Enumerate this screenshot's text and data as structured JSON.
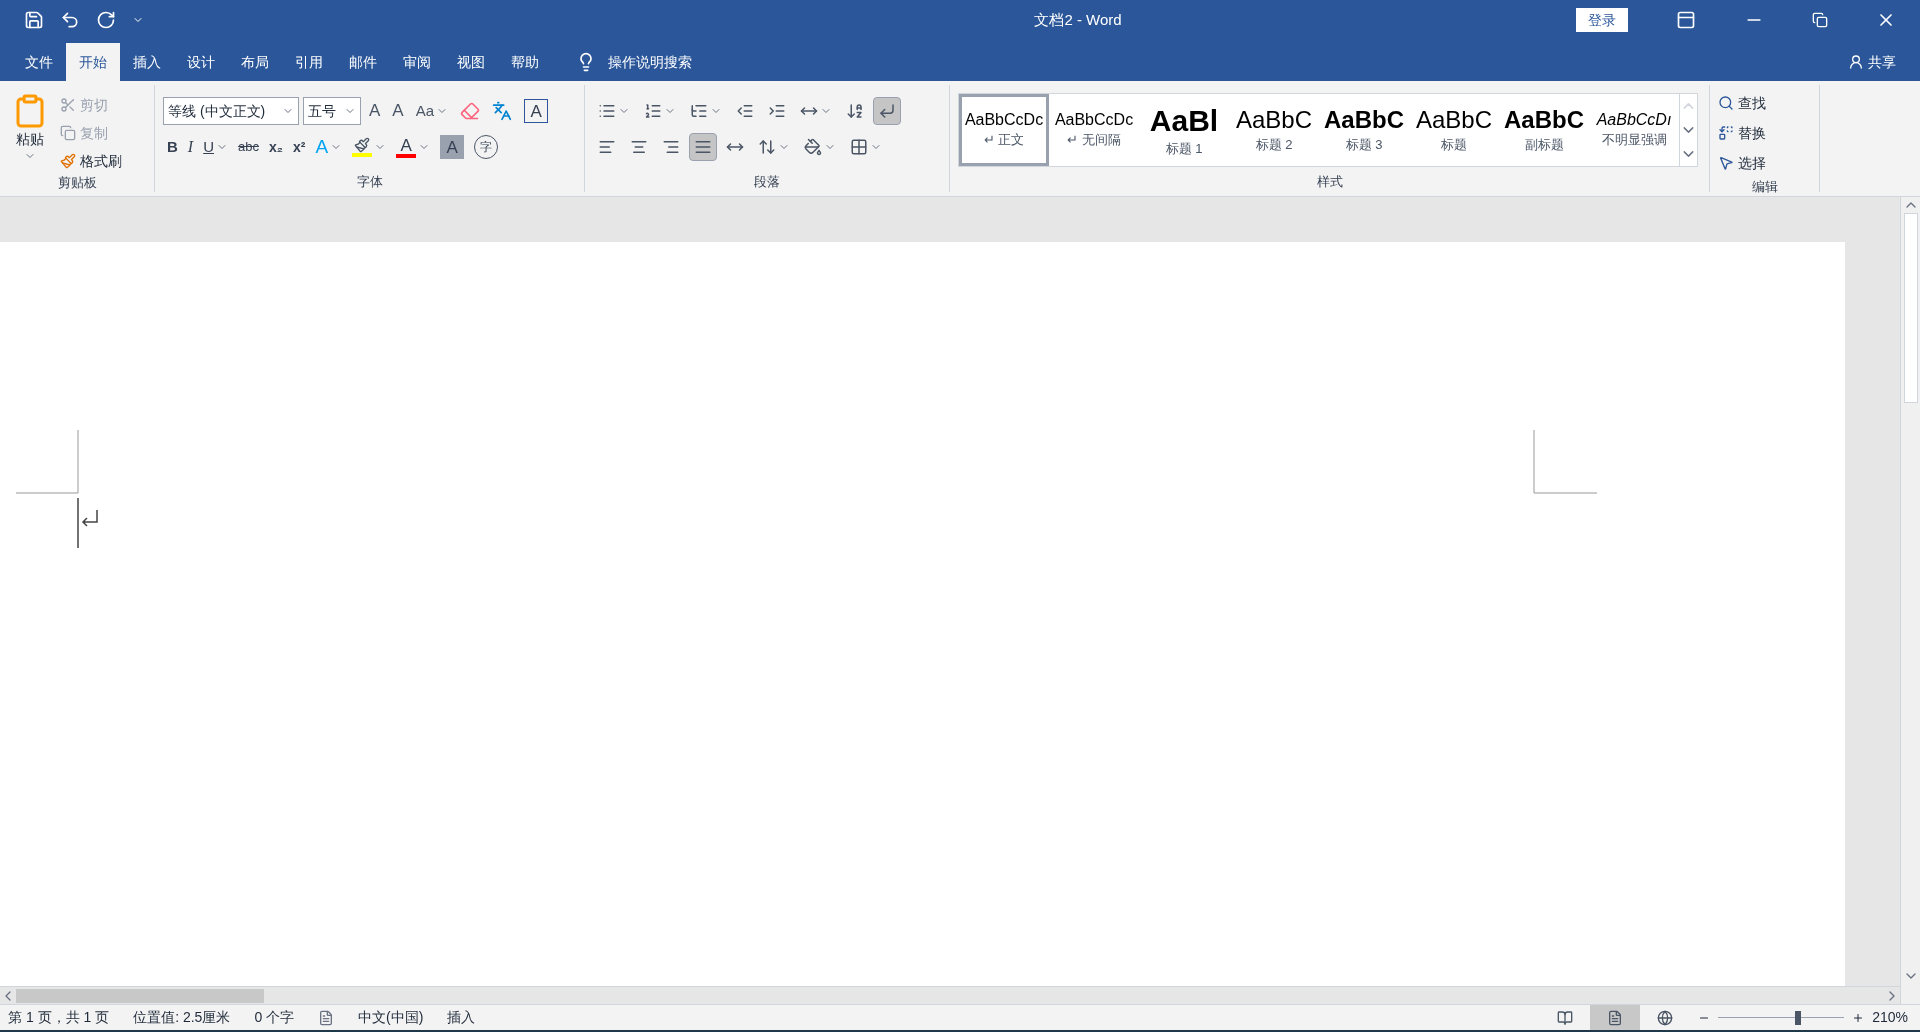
{
  "window": {
    "title": "文档2  -  Word",
    "sign_in": "登录"
  },
  "tabs": [
    {
      "label": "文件",
      "selected": false
    },
    {
      "label": "开始",
      "selected": true
    },
    {
      "label": "插入",
      "selected": false
    },
    {
      "label": "设计",
      "selected": false
    },
    {
      "label": "布局",
      "selected": false
    },
    {
      "label": "引用",
      "selected": false
    },
    {
      "label": "邮件",
      "selected": false
    },
    {
      "label": "审阅",
      "selected": false
    },
    {
      "label": "视图",
      "selected": false
    },
    {
      "label": "帮助",
      "selected": false
    }
  ],
  "tell_me": "操作说明搜索",
  "share": "共享",
  "clipboard": {
    "paste": "粘贴",
    "group": "剪贴板",
    "items": [
      {
        "kind": "cut",
        "label": "剪切",
        "disabled": true
      },
      {
        "kind": "copy",
        "label": "复制",
        "disabled": true
      },
      {
        "kind": "painter",
        "label": "格式刷",
        "disabled": false
      }
    ]
  },
  "font": {
    "name": "等线 (中文正文)",
    "size": "五号",
    "group": "字体",
    "row1": [
      {
        "kind": "grow",
        "label": "A"
      },
      {
        "kind": "shrink",
        "label": "A"
      },
      {
        "kind": "case",
        "label": "Aa"
      },
      {
        "kind": "clear"
      },
      {
        "kind": "phonetic"
      },
      {
        "kind": "border",
        "label": "A"
      }
    ],
    "row2": [
      {
        "kind": "bold",
        "label": "B"
      },
      {
        "kind": "italic",
        "label": "I"
      },
      {
        "kind": "underline",
        "label": "U"
      },
      {
        "kind": "strike",
        "label": "abc"
      },
      {
        "kind": "sub",
        "label": "x₂"
      },
      {
        "kind": "sup",
        "label": "x²"
      },
      {
        "kind": "effect",
        "label": "A"
      },
      {
        "kind": "highlight",
        "color": "#ffff00"
      },
      {
        "kind": "fontcolor",
        "label": "A",
        "color": "#ff0000"
      },
      {
        "kind": "shading",
        "label": "A"
      },
      {
        "kind": "enclose",
        "label": "字"
      }
    ]
  },
  "paragraph": {
    "group": "段落",
    "row1": [
      {
        "kind": "bullets",
        "on": false
      },
      {
        "kind": "numbering",
        "on": false
      },
      {
        "kind": "multilevel",
        "on": false
      },
      {
        "kind": "outdent",
        "on": false
      },
      {
        "kind": "indent",
        "on": false
      },
      {
        "kind": "asian",
        "on": false
      },
      {
        "kind": "sort",
        "on": false
      },
      {
        "kind": "marks",
        "on": true
      }
    ],
    "row2": [
      {
        "kind": "left",
        "on": false
      },
      {
        "kind": "center",
        "on": false
      },
      {
        "kind": "right",
        "on": false
      },
      {
        "kind": "justify",
        "on": true
      },
      {
        "kind": "distribute",
        "on": false
      },
      {
        "kind": "spacing",
        "on": false
      },
      {
        "kind": "shade",
        "on": false
      },
      {
        "kind": "borders",
        "on": false
      }
    ]
  },
  "styles": {
    "group": "样式",
    "items": [
      {
        "sample": "AaBbCcDc",
        "label": "↵ 正文",
        "kind": "normal",
        "selected": true
      },
      {
        "sample": "AaBbCcDc",
        "label": "↵ 无间隔",
        "kind": "normal",
        "selected": false
      },
      {
        "sample": "AaBl",
        "label": "标题 1",
        "kind": "big",
        "selected": false
      },
      {
        "sample": "AaBbC",
        "label": "标题 2",
        "kind": "medium",
        "selected": false
      },
      {
        "sample": "AaBbC",
        "label": "标题 3",
        "kind": "medium-bold",
        "selected": false
      },
      {
        "sample": "AaBbC",
        "label": "标题",
        "kind": "medium",
        "selected": false
      },
      {
        "sample": "AaBbC",
        "label": "副标题",
        "kind": "medium-bold",
        "selected": false
      },
      {
        "sample": "AaBbCcDı",
        "label": "不明显强调",
        "kind": "italic",
        "selected": false
      }
    ]
  },
  "editing": {
    "group": "编辑",
    "items": [
      {
        "kind": "find",
        "label": "查找"
      },
      {
        "kind": "replace",
        "label": "替换"
      },
      {
        "kind": "select",
        "label": "选择"
      }
    ]
  },
  "status_bar": {
    "items": [
      "第 1 页，共 1 页",
      "位置值: 2.5厘米",
      "0 个字",
      "中文(中国)",
      "插入"
    ],
    "views": [
      {
        "kind": "read",
        "selected": false
      },
      {
        "kind": "print",
        "selected": true
      },
      {
        "kind": "web",
        "selected": false
      }
    ],
    "zoom": {
      "level": 0.63,
      "reading": "210%"
    }
  }
}
